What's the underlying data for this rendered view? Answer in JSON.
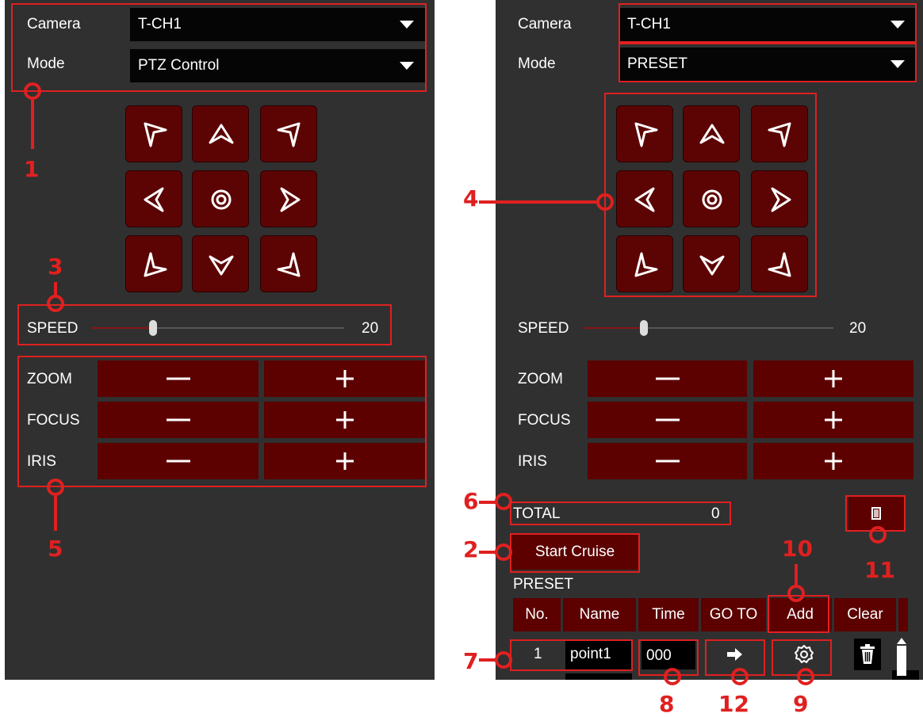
{
  "left": {
    "camera_label": "Camera",
    "camera_value": "T-CH1",
    "mode_label": "Mode",
    "mode_value": "PTZ Control",
    "speed_label": "SPEED",
    "speed_value": "20",
    "zoom_label": "ZOOM",
    "focus_label": "FOCUS",
    "iris_label": "IRIS"
  },
  "right": {
    "camera_label": "Camera",
    "camera_value": "T-CH1",
    "mode_label": "Mode",
    "mode_value": "PRESET",
    "speed_label": "SPEED",
    "speed_value": "20",
    "zoom_label": "ZOOM",
    "focus_label": "FOCUS",
    "iris_label": "IRIS",
    "total_label": "TOTAL",
    "total_value": "0",
    "start_cruise": "Start Cruise",
    "preset_heading": "PRESET",
    "table_headers": [
      "No.",
      "Name",
      "Time",
      "GO TO",
      "Add",
      "Clear"
    ],
    "row": {
      "no": "1",
      "name": "point1",
      "time": "000"
    }
  },
  "speed_fraction": 0.2,
  "callouts": [
    "1",
    "2",
    "3",
    "4",
    "5",
    "6",
    "7",
    "8",
    "9",
    "10",
    "11",
    "12"
  ],
  "colors": {
    "panel": "#303030",
    "button": "#5c0000",
    "accent": "#e02020"
  }
}
